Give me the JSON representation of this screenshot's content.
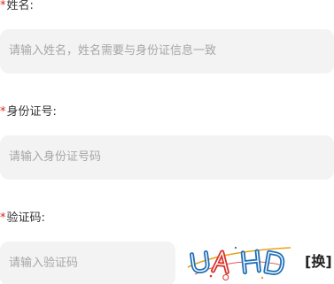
{
  "form": {
    "required_mark": "*",
    "name": {
      "label": "姓名:",
      "placeholder": "请输入姓名，姓名需要与身份证信息一致"
    },
    "id_number": {
      "label": "身份证号:",
      "placeholder": "请输入身份证号码"
    },
    "captcha": {
      "label": "验证码:",
      "placeholder": "请输入验证码",
      "image_text": "UAHD",
      "refresh_label": "[换]"
    }
  },
  "colors": {
    "required": "#e02020",
    "input_background": "#f3f3f3",
    "placeholder": "#a6a6a6",
    "captcha_blue": "#1f6fb8",
    "captcha_red": "#d8342c",
    "captcha_orange": "#e8a21a"
  }
}
